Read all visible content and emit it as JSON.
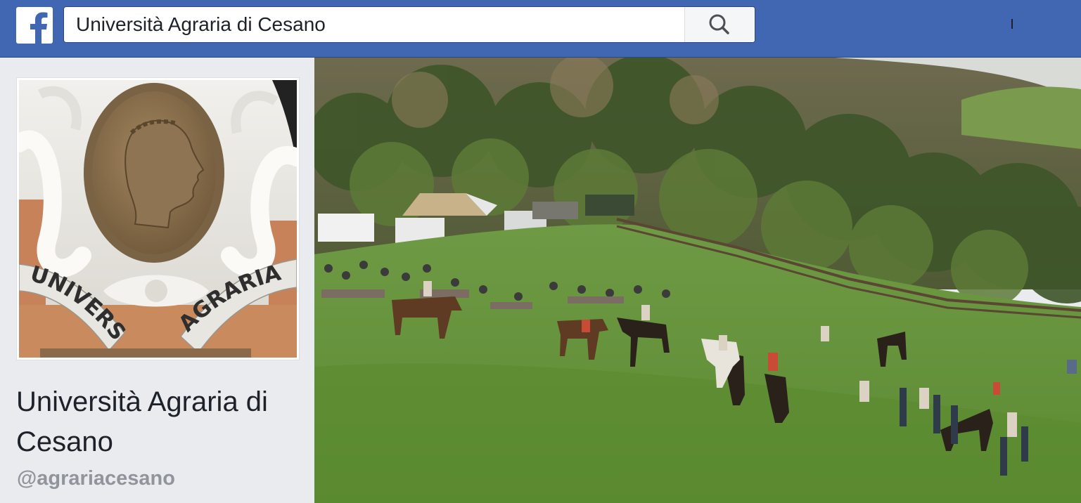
{
  "topbar": {
    "logo_icon": "facebook-f-icon",
    "search": {
      "value": "Università Agraria di Cesano"
    },
    "search_icon": "search-icon",
    "brand_color": "#4267b2"
  },
  "page": {
    "profile_picture": {
      "icon": "university-crest-image",
      "text_left": "UNIVERSITÀ",
      "text_right": "AGRARIA"
    },
    "name": "Università Agraria di Cesano",
    "handle": "@agrariacesano"
  },
  "cover_photo": {
    "icon": "horse-event-field-photo"
  }
}
